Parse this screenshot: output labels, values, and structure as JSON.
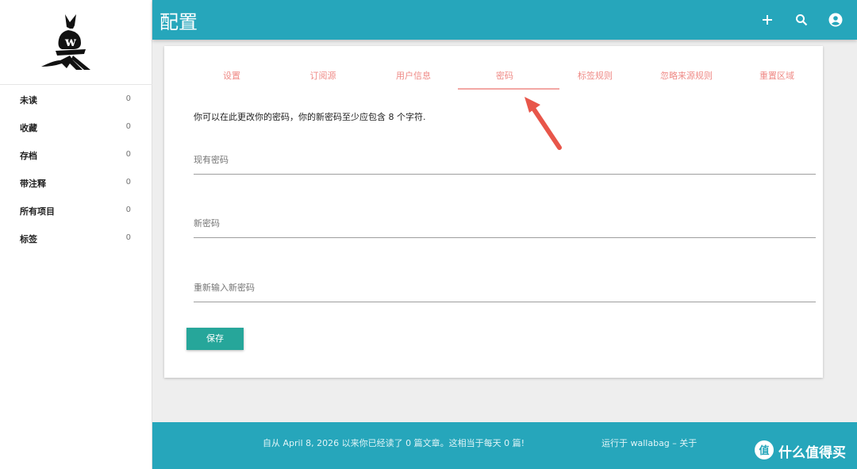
{
  "sidebar": {
    "items": [
      {
        "label": "未读",
        "count": "0"
      },
      {
        "label": "收藏",
        "count": "0"
      },
      {
        "label": "存档",
        "count": "0"
      },
      {
        "label": "带注释",
        "count": "0"
      },
      {
        "label": "所有项目",
        "count": "0"
      },
      {
        "label": "标签",
        "count": "0"
      }
    ]
  },
  "header": {
    "title": "配置",
    "icons": [
      "add-icon",
      "search-icon",
      "account-icon"
    ]
  },
  "tabs": [
    {
      "label": "设置"
    },
    {
      "label": "订阅源"
    },
    {
      "label": "用户信息"
    },
    {
      "label": "密码",
      "active": true
    },
    {
      "label": "标签规则"
    },
    {
      "label": "忽略来源规则"
    },
    {
      "label": "重置区域"
    }
  ],
  "form": {
    "intro": "你可以在此更改你的密码，你的新密码至少应包含 8 个字符.",
    "fields": [
      {
        "label": "现有密码",
        "value": ""
      },
      {
        "label": "新密码",
        "value": ""
      },
      {
        "label": "重新输入新密码",
        "value": ""
      }
    ],
    "save_label": "保存"
  },
  "footer": {
    "stats": "自从 April 8, 2026 以来你已经读了 0 篇文章。这相当于每天 0 篇!",
    "powered": "运行于 wallabag – 关于"
  },
  "watermark": {
    "text": "什么值得买",
    "icon_char": "值"
  },
  "colors": {
    "accent": "#26a6bb",
    "tab_text": "#ef8a86",
    "save_button": "#26a69a",
    "annotation_arrow": "#e8564a"
  }
}
